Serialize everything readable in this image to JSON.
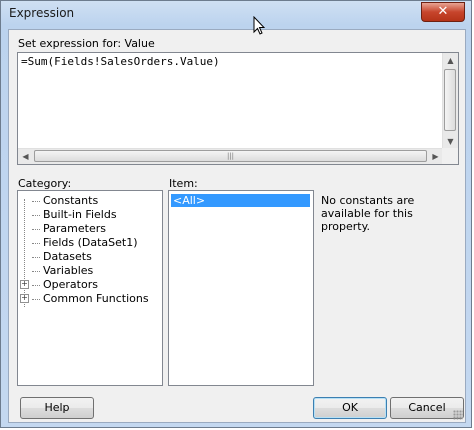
{
  "window": {
    "title": "Expression",
    "close_glyph": "✕"
  },
  "expression": {
    "label": "Set expression for: Value",
    "value": "=Sum(Fields!SalesOrders.Value)"
  },
  "category": {
    "label": "Category:",
    "items": [
      {
        "label": "Constants",
        "expandable": false
      },
      {
        "label": "Built-in Fields",
        "expandable": false
      },
      {
        "label": "Parameters",
        "expandable": false
      },
      {
        "label": "Fields (DataSet1)",
        "expandable": false
      },
      {
        "label": "Datasets",
        "expandable": false
      },
      {
        "label": "Variables",
        "expandable": false
      },
      {
        "label": "Operators",
        "expandable": true
      },
      {
        "label": "Common Functions",
        "expandable": true
      }
    ],
    "expander_glyph": "+"
  },
  "item": {
    "label": "Item:",
    "selected": "<All>"
  },
  "description": {
    "text": "No constants are available for this property."
  },
  "buttons": {
    "help": "Help",
    "ok": "OK",
    "cancel": "Cancel"
  },
  "icons": {
    "scroll_up": "scroll-up-arrow",
    "scroll_down": "scroll-down-arrow",
    "scroll_left": "scroll-left-arrow",
    "scroll_right": "scroll-right-arrow"
  }
}
